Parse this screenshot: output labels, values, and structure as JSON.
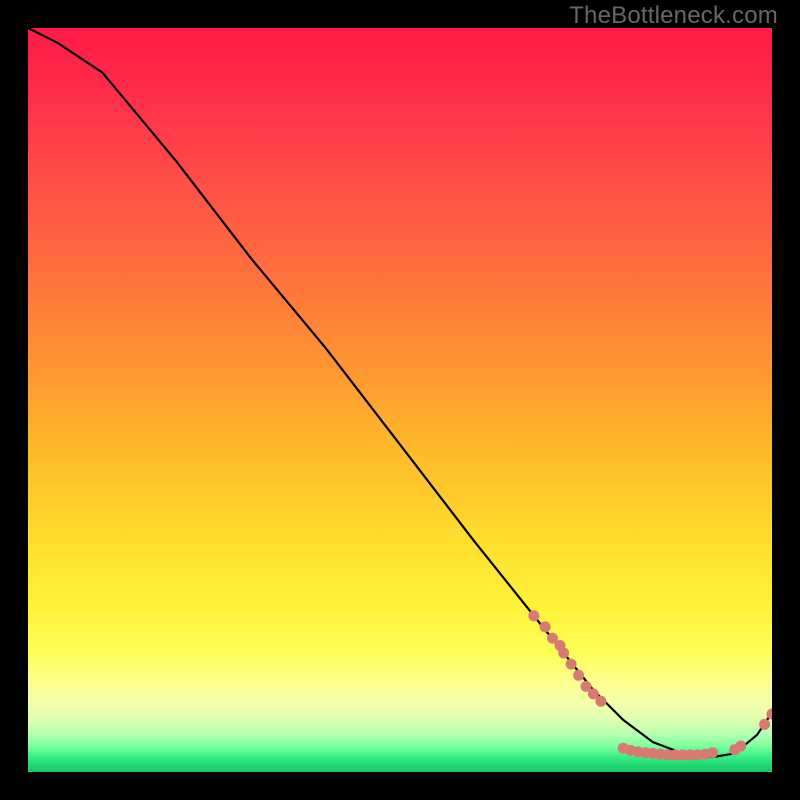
{
  "watermark": "TheBottleneck.com",
  "chart_data": {
    "type": "line",
    "title": "",
    "xlabel": "",
    "ylabel": "",
    "xlim": [
      0,
      100
    ],
    "ylim": [
      0,
      100
    ],
    "grid": false,
    "legend": false,
    "series": [
      {
        "name": "curve",
        "color": "#000000",
        "x": [
          0,
          4,
          10,
          20,
          30,
          40,
          50,
          60,
          68,
          72,
          76,
          80,
          84,
          88,
          92,
          95,
          98,
          100
        ],
        "y": [
          100,
          98,
          94,
          82,
          69,
          57,
          44,
          31,
          21,
          16,
          11,
          7,
          4,
          2.5,
          2,
          2.5,
          5,
          8
        ]
      }
    ],
    "scatter_clusters": [
      {
        "name": "cluster-upper",
        "color": "#d87a73",
        "x": [
          68,
          69.5,
          70.5,
          71.5,
          72,
          73,
          74,
          75,
          76,
          77
        ],
        "y": [
          21,
          19.5,
          18,
          17,
          16,
          14.5,
          13,
          11.5,
          10.5,
          9.5
        ]
      },
      {
        "name": "cluster-bottom",
        "color": "#d87a73",
        "x": [
          80,
          81,
          82,
          83,
          84,
          85,
          86,
          87,
          88,
          89,
          90,
          91,
          92
        ],
        "y": [
          3.2,
          2.9,
          2.7,
          2.6,
          2.5,
          2.4,
          2.3,
          2.3,
          2.3,
          2.3,
          2.3,
          2.4,
          2.6
        ]
      },
      {
        "name": "cluster-tail",
        "color": "#d87a73",
        "x": [
          95,
          95.8,
          99,
          100
        ],
        "y": [
          3.0,
          3.5,
          6.4,
          7.8
        ]
      }
    ],
    "gradient_background": {
      "top_color": "#ff1a47",
      "mid_color": "#ffe12e",
      "bottom_color": "#17c968"
    }
  }
}
